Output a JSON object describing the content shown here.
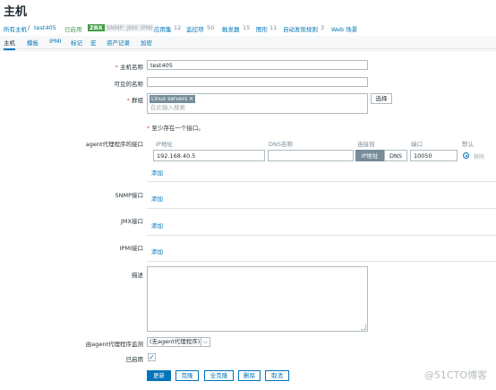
{
  "page": {
    "title": "主机"
  },
  "breadcrumb": {
    "all_hosts": "所有主机",
    "separator": "/",
    "host": "test405",
    "enabled": "已启用",
    "zbx": "ZBX",
    "snmp": "SNMP",
    "jmx": "JMX",
    "ipmi": "IPMI",
    "applications": "应用集",
    "applications_count": "12",
    "items": "监控项",
    "items_count": "50",
    "triggers": "触发器",
    "triggers_count": "15",
    "graphs": "图形",
    "graphs_count": "11",
    "discovery": "自动发现规则",
    "discovery_count": "3",
    "web": "Web 场景"
  },
  "tabs": [
    "主机",
    "模板",
    "IPMI",
    "标记",
    "宏",
    "资产记录",
    "加密"
  ],
  "form": {
    "host_name_label": "主机名称",
    "host_name_value": "test405",
    "visible_name_label": "可见的名称",
    "visible_name_value": "",
    "groups_label": "群组",
    "group_chip": "Linux servers",
    "group_chip_remove": "✕",
    "groups_placeholder": "在此输入搜索",
    "select_button": "选择",
    "required_asterisk": "*",
    "interface_note": "至少存在一个接口。",
    "agent_label": "agent代理程序的接口",
    "col_ip": "IP地址",
    "col_dns": "DNS名称",
    "col_connect": "连接到",
    "col_port": "端口",
    "col_default": "默认",
    "ip_value": "192.168.40.5",
    "dns_value": "",
    "connect_ip": "IP地址",
    "connect_dns": "DNS",
    "port_value": "10050",
    "remove_link": "移除",
    "add_link": "添加",
    "snmp_label": "SNMP接口",
    "jmx_label": "JMX接口",
    "ipmi_label": "IPMI接口",
    "description_label": "描述",
    "proxy_label": "由agent代理程序监测",
    "proxy_value": "(无agent代理程序)",
    "enabled_label": "已启用",
    "enabled_checked": true
  },
  "buttons": {
    "update": "更新",
    "clone": "克隆",
    "full_clone": "全克隆",
    "delete": "删除",
    "cancel": "取消"
  },
  "watermark": "@51CTO博客",
  "colors": {
    "accent": "#0275b8",
    "enabled_green": "#429e47",
    "required_red": "#e45959"
  }
}
